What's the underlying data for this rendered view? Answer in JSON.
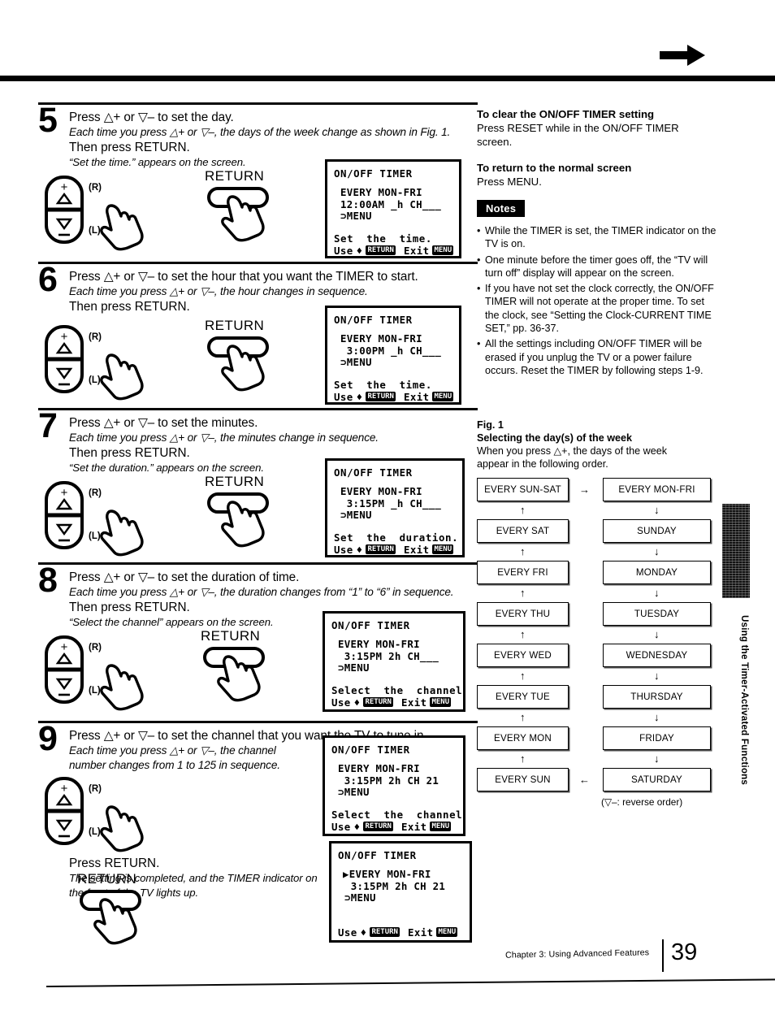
{
  "header": {
    "arrow_icon": "arrow-right-icon"
  },
  "steps": [
    {
      "number": "5",
      "line1": "Press △+ or ▽– to set the day.",
      "line2": "Each time you press △+ or ▽–, the days of the week change as shown in Fig. 1.",
      "line3": "Then press RETURN.",
      "line4": "“Set the time.” appears on the screen.",
      "remote": {
        "plus": "+",
        "up": "△",
        "down": "▽",
        "minus": "−",
        "right_label": "(R)",
        "left_label": "(L)"
      },
      "return_label": "RETURN",
      "osd": {
        "title": "ON/OFF  TIMER",
        "line1": "EVERY MON-FRI",
        "line2": "12:00AM _h CH___",
        "line3": "⊃MENU",
        "status": "Set  the  time.",
        "use_label": "Use",
        "use_glyph": "♦",
        "return_key": "RETURN",
        "exit_label": "Exit",
        "menu_key": "MENU"
      }
    },
    {
      "number": "6",
      "line1": "Press △+ or ▽– to set the hour that you want the TIMER to start.",
      "line2": "Each time you press △+ or ▽–, the hour changes in sequence.",
      "line3": "Then press RETURN.",
      "line4": "",
      "remote": {
        "plus": "+",
        "up": "△",
        "down": "▽",
        "minus": "−",
        "right_label": "(R)",
        "left_label": "(L)"
      },
      "return_label": "RETURN",
      "osd": {
        "title": "ON/OFF  TIMER",
        "line1": "EVERY MON-FRI",
        "line2": " 3:00PM _h CH___",
        "line3": "⊃MENU",
        "status": "Set  the  time.",
        "use_label": "Use",
        "use_glyph": "♦",
        "return_key": "RETURN",
        "exit_label": "Exit",
        "menu_key": "MENU"
      }
    },
    {
      "number": "7",
      "line1": "Press △+ or ▽– to set the minutes.",
      "line2": "Each time you press △+ or ▽–, the minutes change in sequence.",
      "line3": "Then press RETURN.",
      "line4": "“Set the duration.” appears on the screen.",
      "remote": {
        "plus": "+",
        "up": "△",
        "down": "▽",
        "minus": "−",
        "right_label": "(R)",
        "left_label": "(L)"
      },
      "return_label": "RETURN",
      "osd": {
        "title": "ON/OFF  TIMER",
        "line1": "EVERY MON-FRI",
        "line2": " 3:15PM _h CH___",
        "line3": "⊃MENU",
        "status": "Set  the  duration.",
        "use_label": "Use",
        "use_glyph": "♦",
        "return_key": "RETURN",
        "exit_label": "Exit",
        "menu_key": "MENU"
      }
    },
    {
      "number": "8",
      "line1": "Press △+ or ▽– to set the duration of time.",
      "line2": "Each time you press △+ or ▽–, the duration changes from “1” to “6” in sequence.",
      "line3": "Then press RETURN.",
      "line4": "“Select the channel” appears on the screen.",
      "remote": {
        "plus": "+",
        "up": "△",
        "down": "▽",
        "minus": "−",
        "right_label": "(R)",
        "left_label": "(L)"
      },
      "return_label": "RETURN",
      "osd": {
        "title": "ON/OFF  TIMER",
        "line1": "EVERY MON-FRI",
        "line2": " 3:15PM 2h CH___",
        "line3": "⊃MENU",
        "status": "Select  the  channel",
        "use_label": "Use",
        "use_glyph": "♦",
        "return_key": "RETURN",
        "exit_label": "Exit",
        "menu_key": "MENU"
      }
    },
    {
      "number": "9",
      "line1": "Press △+ or ▽– to set the channel that you want the TV to tune in.",
      "line2": "Each time you press △+ or ▽–, the channel",
      "line2b": "number changes from 1 to 125 in sequence.",
      "remote": {
        "plus": "+",
        "up": "△",
        "down": "▽",
        "minus": "−",
        "right_label": "(R)",
        "left_label": "(L)"
      },
      "osd": {
        "title": "ON/OFF  TIMER",
        "line1": "EVERY MON-FRI",
        "line2": " 3:15PM 2h CH 21",
        "line3": "⊃MENU",
        "status": "Select  the  channel",
        "use_label": "Use",
        "use_glyph": "♦",
        "return_key": "RETURN",
        "exit_label": "Exit",
        "menu_key": "MENU"
      }
    }
  ],
  "final": {
    "line1": "Press RETURN.",
    "line2": "The setting is completed, and the TIMER indicator on",
    "line3": "the front of the TV lights up.",
    "return_label": "RETURN",
    "osd": {
      "title": "ON/OFF  TIMER",
      "line1": "▶EVERY MON-FRI",
      "line2": " 3:15PM 2h CH 21",
      "line3": "⊃MENU",
      "use_label": "Use",
      "use_glyph": "♦",
      "return_key": "RETURN",
      "exit_label": "Exit",
      "menu_key": "MENU"
    }
  },
  "right": {
    "clear_heading": "To clear the ON/OFF TIMER setting",
    "clear_body1": "Press RESET while in the ON/OFF TIMER",
    "clear_body2": "screen.",
    "return_heading": "To return to the normal screen",
    "return_body": "Press MENU.",
    "notes_label": "Notes",
    "notes": [
      "While the TIMER is set, the TIMER indicator on the TV is on.",
      "One minute before the timer goes off, the “TV will turn off” display will appear on the screen.",
      "If you have not set the clock correctly, the ON/OFF TIMER will not operate at the proper time. To set the clock, see “Setting the Clock-CURRENT TIME SET,” pp. 36-37.",
      "All the settings including ON/OFF TIMER will be erased if you unplug the TV or a power failure occurs. Reset the TIMER by following steps 1-9."
    ]
  },
  "fig": {
    "label": "Fig. 1",
    "title": "Selecting the day(s) of the week",
    "desc1": "When you press △+, the days of the week",
    "desc2": "appear in the following order.",
    "left_column": [
      "EVERY SUN-SAT",
      "EVERY SAT",
      "EVERY FRI",
      "EVERY THU",
      "EVERY WED",
      "EVERY TUE",
      "EVERY MON",
      "EVERY SUN"
    ],
    "right_column": [
      "EVERY MON-FRI",
      "SUNDAY",
      "MONDAY",
      "TUESDAY",
      "WEDNESDAY",
      "THURSDAY",
      "FRIDAY",
      "SATURDAY"
    ],
    "arrow_top": "→",
    "arrow_bottom": "←",
    "arrow_up": "↑",
    "arrow_down": "↓",
    "footnote": "(▽–:  reverse order)"
  },
  "side_tab": {
    "text": "Using the Timer-Activated Functions"
  },
  "footer": {
    "chapter": "Chapter 3: Using Advanced Features",
    "page": "39"
  }
}
